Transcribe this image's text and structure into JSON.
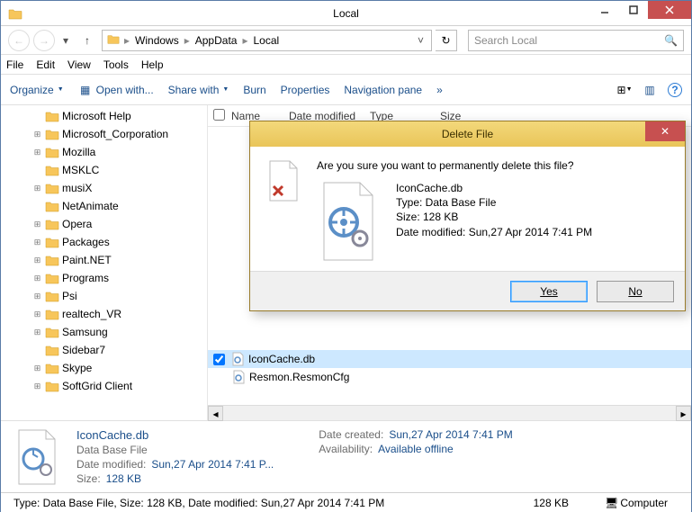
{
  "window": {
    "title": "Local"
  },
  "nav": {
    "breadcrumbs": [
      "Windows",
      "AppData",
      "Local"
    ],
    "search_placeholder": "Search Local"
  },
  "menu": {
    "file": "File",
    "edit": "Edit",
    "view": "View",
    "tools": "Tools",
    "help": "Help"
  },
  "toolbar": {
    "organize": "Organize",
    "openwith": "Open with...",
    "sharewith": "Share with",
    "burn": "Burn",
    "properties": "Properties",
    "navpane": "Navigation pane"
  },
  "columns": {
    "name": "Name",
    "date": "Date modified",
    "type": "Type",
    "size": "Size"
  },
  "tree": [
    {
      "label": "Microsoft Help",
      "expander": ""
    },
    {
      "label": "Microsoft_Corporation",
      "expander": "+"
    },
    {
      "label": "Mozilla",
      "expander": "+"
    },
    {
      "label": "MSKLC",
      "expander": ""
    },
    {
      "label": "musiX",
      "expander": "+"
    },
    {
      "label": "NetAnimate",
      "expander": ""
    },
    {
      "label": "Opera",
      "expander": "+"
    },
    {
      "label": "Packages",
      "expander": "+"
    },
    {
      "label": "Paint.NET",
      "expander": "+"
    },
    {
      "label": "Programs",
      "expander": "+"
    },
    {
      "label": "Psi",
      "expander": "+"
    },
    {
      "label": "realtech_VR",
      "expander": "+"
    },
    {
      "label": "Samsung",
      "expander": "+"
    },
    {
      "label": "Sidebar7",
      "expander": ""
    },
    {
      "label": "Skype",
      "expander": "+"
    },
    {
      "label": "SoftGrid Client",
      "expander": "+"
    }
  ],
  "files": [
    {
      "name": "IconCache.db",
      "selected": true
    },
    {
      "name": "Resmon.ResmonCfg",
      "selected": false
    }
  ],
  "details": {
    "name": "IconCache.db",
    "type": "Data Base File",
    "date_modified_label": "Date modified:",
    "date_modified": "Sun,27 Apr 2014 7:41 P...",
    "size_label": "Size:",
    "size": "128 KB",
    "date_created_label": "Date created:",
    "date_created": "Sun,27 Apr 2014 7:41 PM",
    "availability_label": "Availability:",
    "availability": "Available offline"
  },
  "status": {
    "left": "Type: Data Base File, Size: 128 KB, Date modified: Sun,27 Apr 2014 7:41 PM",
    "size": "128 KB",
    "location": "Computer"
  },
  "dialog": {
    "title": "Delete File",
    "question": "Are you sure you want to permanently delete this file?",
    "file_name": "IconCache.db",
    "file_type": "Type: Data Base File",
    "file_size": "Size: 128 KB",
    "file_date": "Date modified: Sun,27 Apr 2014 7:41 PM",
    "yes": "Yes",
    "no": "No"
  }
}
